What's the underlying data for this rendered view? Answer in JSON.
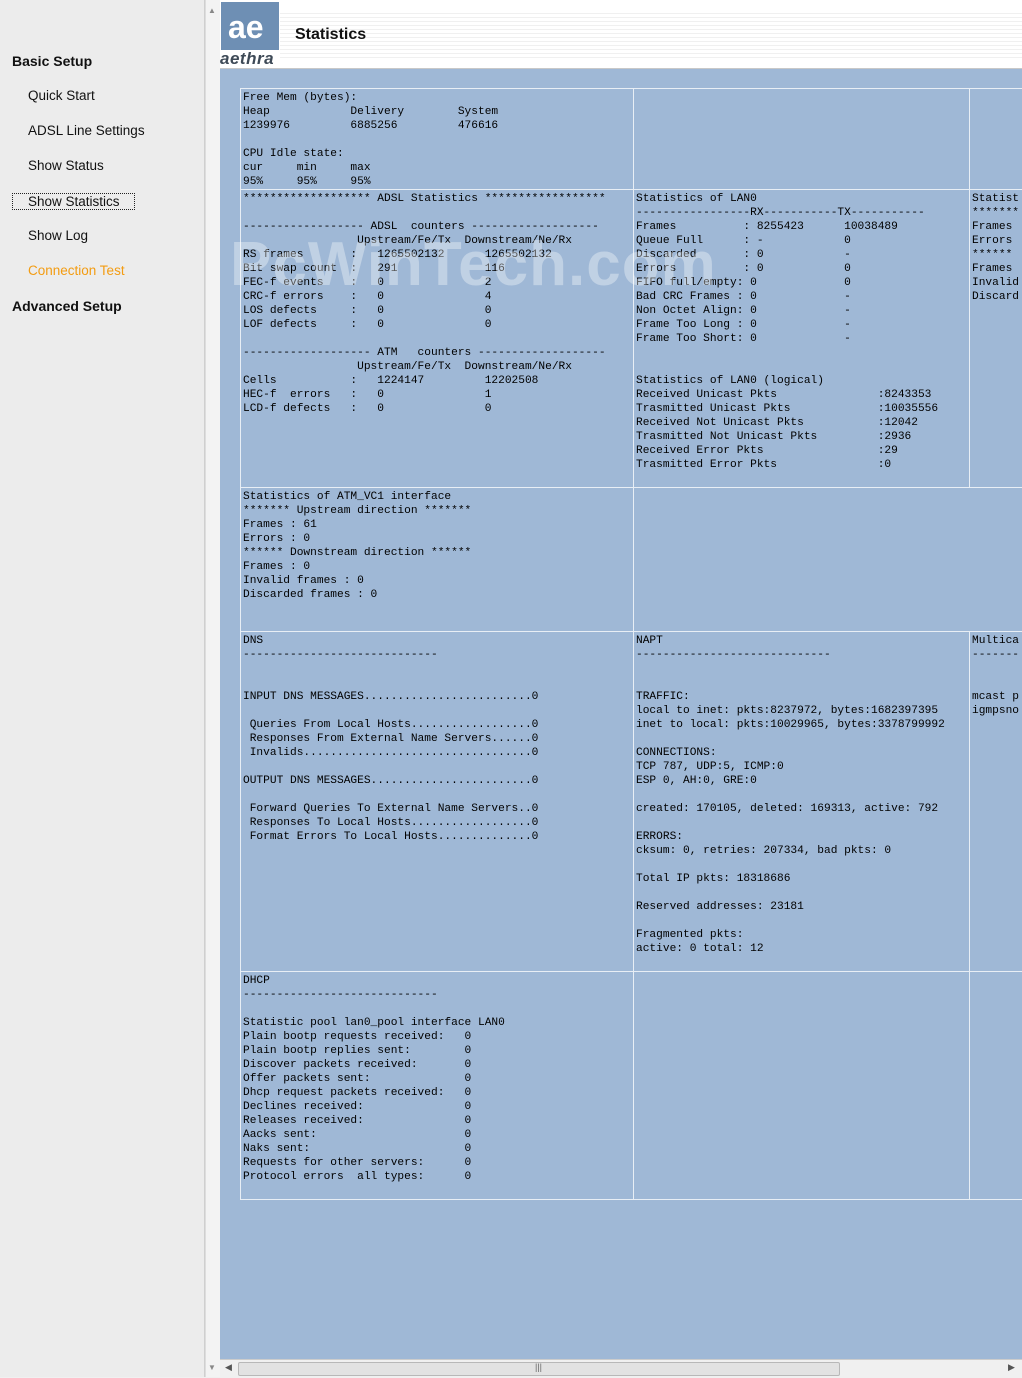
{
  "nav": {
    "basic_setup": "Basic Setup",
    "items": [
      "Quick Start",
      "ADSL Line Settings",
      "Show Status",
      "Show Statistics",
      "Show Log",
      "Connection Test"
    ],
    "advanced_setup": "Advanced Setup"
  },
  "header": {
    "logo_glyph": "ae",
    "logo_word": "aethra",
    "title": "Statistics"
  },
  "watermark": "PcWinTech.com",
  "cells": {
    "mem": "Free Mem (bytes):\nHeap            Delivery        System\n1239976         6885256         476616\n\nCPU Idle state:\ncur     min     max\n95%     95%     95%",
    "adsl": "******************* ADSL Statistics ******************\n\n------------------ ADSL  counters -------------------\n                 Upstream/Fe/Tx  Downstream/Ne/Rx\nRS frames       :   1265502132      1265502132\nBit swap count  :   291             116\nFEC-f events    :   0               2\nCRC-f errors    :   0               4\nLOS defects     :   0               0\nLOF defects     :   0               0\n\n------------------- ATM   counters -------------------\n                 Upstream/Fe/Tx  Downstream/Ne/Rx\nCells           :   1224147         12202508\nHEC-f  errors   :   0               1\nLCD-f defects   :   0               0",
    "lan0": "Statistics of LAN0\n-----------------RX-----------TX-----------\nFrames          : 8255423      10038489\nQueue Full      : -            0\nDiscarded       : 0            -\nErrors          : 0            0\nFIFO full/empty: 0             0\nBad CRC Frames : 0             -\nNon Octet Align: 0             -\nFrame Too Long : 0             -\nFrame Too Short: 0             -\n\n\nStatistics of LAN0 (logical)\nReceived Unicast Pkts               :8243353\nTrasmitted Unicast Pkts             :10035556\nReceived Not Unicast Pkts           :12042\nTrasmitted Not Unicast Pkts         :2936\nReceived Error Pkts                 :29\nTrasmitted Error Pkts               :0",
    "right_mid": "Statist\n*******\nFrames\nErrors\n****** \nFrames\nInvalid\nDiscard",
    "atm": "Statistics of ATM_VC1 interface\n******* Upstream direction *******\nFrames : 61\nErrors : 0\n****** Downstream direction ******\nFrames : 0\nInvalid frames : 0\nDiscarded frames : 0",
    "dns": "DNS\n-----------------------------\n\n\nINPUT DNS MESSAGES.........................0\n\n Queries From Local Hosts..................0\n Responses From External Name Servers......0\n Invalids..................................0\n\nOUTPUT DNS MESSAGES........................0\n\n Forward Queries To External Name Servers..0\n Responses To Local Hosts..................0\n Format Errors To Local Hosts..............0",
    "napt": "NAPT\n-----------------------------\n\n\nTRAFFIC:\nlocal to inet: pkts:8237972, bytes:1682397395\ninet to local: pkts:10029965, bytes:3378799992\n\nCONNECTIONS:\nTCP 787, UDP:5, ICMP:0\nESP 0, AH:0, GRE:0\n\ncreated: 170105, deleted: 169313, active: 792\n\nERRORS:\ncksum: 0, retries: 207334, bad pkts: 0\n\nTotal IP pkts: 18318686\n\nReserved addresses: 23181\n\nFragmented pkts:\nactive: 0 total: 12",
    "multicast": "Multica\n-------\n\n\nmcast p\nigmpsno",
    "dhcp": "DHCP\n-----------------------------\n\nStatistic pool lan0_pool interface LAN0\nPlain bootp requests received:   0\nPlain bootp replies sent:        0\nDiscover packets received:       0\nOffer packets sent:              0\nDhcp request packets received:   0\nDeclines received:               0\nReleases received:               0\nAacks sent:                      0\nNaks sent:                       0\nRequests for other servers:      0\nProtocol errors  all types:      0"
  }
}
